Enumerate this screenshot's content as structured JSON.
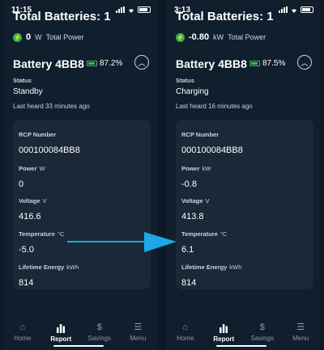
{
  "screens": [
    {
      "time": "11:15",
      "total_batteries": "Total Batteries: 1",
      "power_value": "0",
      "power_unit": "W",
      "power_label": "Total Power",
      "battery_name": "Battery 4BB8",
      "battery_percent": "87.2%",
      "status_label": "Status",
      "status_value": "Standby",
      "last_heard": "Last heard 33 minutes ago",
      "fields": [
        {
          "label": "RCP Number",
          "unit": "",
          "value": "000100084BB8"
        },
        {
          "label": "Power",
          "unit": "W",
          "value": "0"
        },
        {
          "label": "Voltage",
          "unit": "V",
          "value": "416.6"
        },
        {
          "label": "Temperature",
          "unit": "°C",
          "value": "-5.0"
        },
        {
          "label": "Lifetime Energy",
          "unit": "kWh",
          "value": "814"
        }
      ],
      "nav": [
        {
          "label": "Home",
          "icon": "home-icon"
        },
        {
          "label": "Report",
          "icon": "bar-chart-icon"
        },
        {
          "label": "Savings",
          "icon": "dollar-icon"
        },
        {
          "label": "Menu",
          "icon": "menu-icon"
        }
      ]
    },
    {
      "time": "3:13",
      "total_batteries": "Total Batteries: 1",
      "power_value": "-0.80",
      "power_unit": "kW",
      "power_label": "Total Power",
      "battery_name": "Battery 4BB8",
      "battery_percent": "87.5%",
      "status_label": "Status",
      "status_value": "Charging",
      "last_heard": "Last heard 16 minutes ago",
      "fields": [
        {
          "label": "RCP Number",
          "unit": "",
          "value": "000100084BB8"
        },
        {
          "label": "Power",
          "unit": "kW",
          "value": "-0.8"
        },
        {
          "label": "Voltage",
          "unit": "V",
          "value": "413.8"
        },
        {
          "label": "Temperature",
          "unit": "°C",
          "value": "6.1"
        },
        {
          "label": "Lifetime Energy",
          "unit": "kWh",
          "value": "814"
        }
      ],
      "nav": [
        {
          "label": "Home",
          "icon": "home-icon"
        },
        {
          "label": "Report",
          "icon": "bar-chart-icon"
        },
        {
          "label": "Savings",
          "icon": "dollar-icon"
        },
        {
          "label": "Menu",
          "icon": "menu-icon"
        }
      ]
    }
  ],
  "active_nav": "Report",
  "colors": {
    "background": "#101e2d",
    "card": "#1a2837",
    "accent_green": "#2fb34c",
    "arrow": "#1ea7e8"
  }
}
